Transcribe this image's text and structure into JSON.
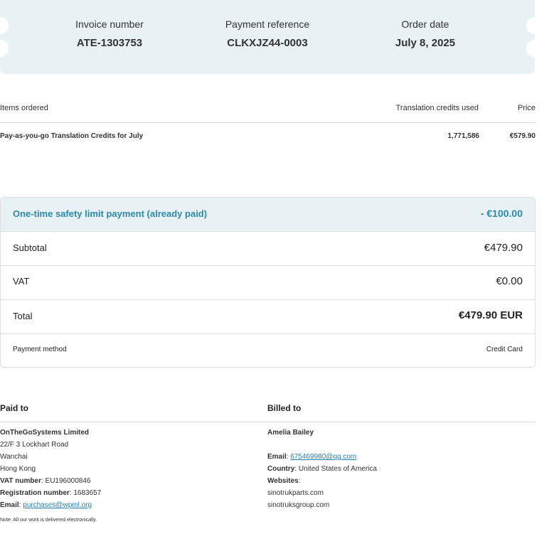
{
  "header": {
    "invoice_number_label": "Invoice number",
    "invoice_number": "ATE-1303753",
    "payment_reference_label": "Payment reference",
    "payment_reference": "CLKXJZ44-0003",
    "order_date_label": "Order date",
    "order_date": "July 8, 2025"
  },
  "items": {
    "headers": {
      "item": "Items ordered",
      "credits": "Translation credits used",
      "price": "Price"
    },
    "rows": [
      {
        "item": "Pay-as-you-go Translation Credits for July",
        "credits": "1,771,586",
        "price": "€579.90"
      }
    ]
  },
  "summary": {
    "safety_label": "One-time safety limit payment (already paid)",
    "safety_value": "- €100.00",
    "subtotal_label": "Subtotal",
    "subtotal_value": "€479.90",
    "vat_label": "VAT",
    "vat_value": "€0.00",
    "total_label": "Total",
    "total_value": "€479.90 EUR",
    "payment_method_label": "Payment method",
    "payment_method_value": "Credit Card"
  },
  "paid_to": {
    "title": "Paid to",
    "company": "OnTheGoSystems Limited",
    "address1": "22/F 3 Lockhart Road",
    "address2": "Wanchai",
    "address3": "Hong Kong",
    "vat_label": "VAT number",
    "vat_value": "EU196000846",
    "reg_label": "Registration number",
    "reg_value": "1683657",
    "email_label": "Email",
    "email_value": "purchases@wpml.org"
  },
  "billed_to": {
    "title": "Billed to",
    "name": "Amelia Bailey",
    "email_label": "Email",
    "email_value": "675469980@qq.com",
    "country_label": "Country",
    "country_value": "United States of America",
    "websites_label": "Websites",
    "website1": "sinotrukparts.com",
    "website2": "sinotruksgroup.com"
  },
  "note": "Note: All our work is delivered electronically.",
  "colors": {
    "accent": "#2b8aa8",
    "header_bg": "#e8f1f3",
    "link": "#2b7fa6"
  }
}
